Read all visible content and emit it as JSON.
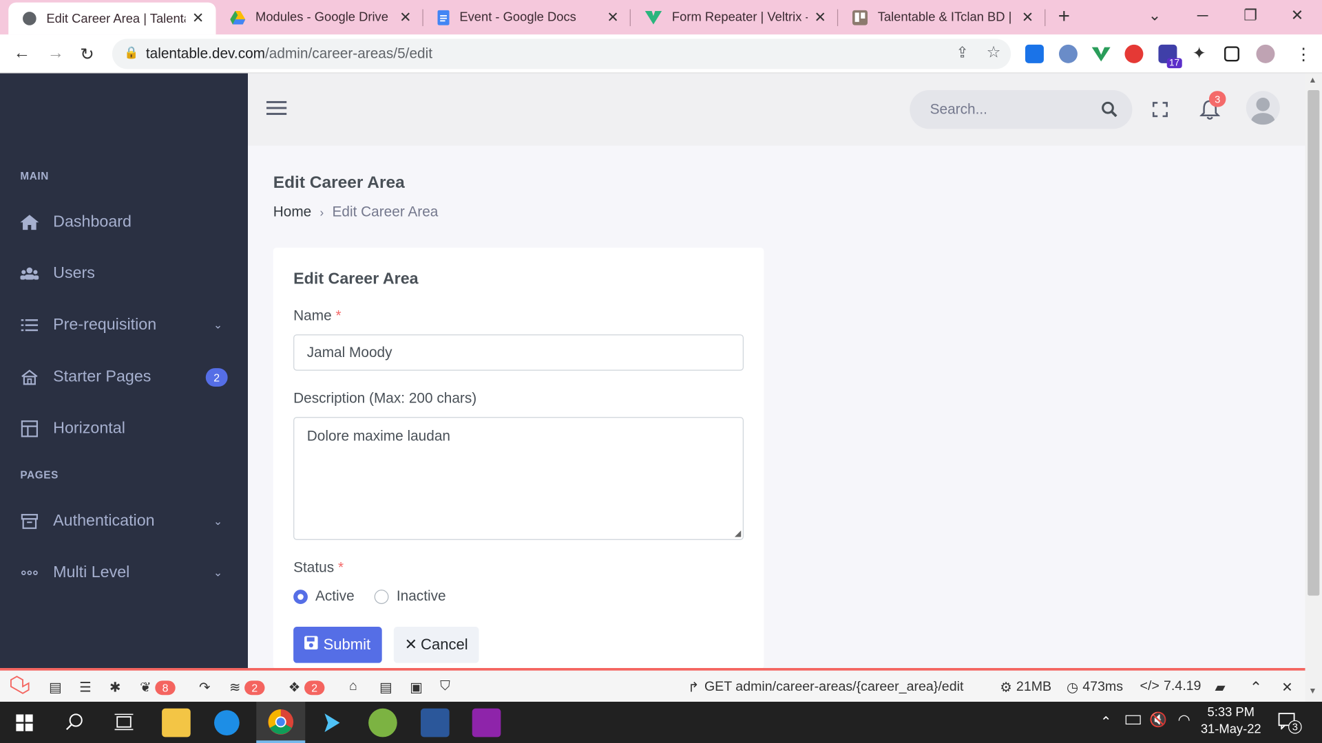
{
  "browser": {
    "tabs": [
      {
        "title": "Edit Career Area | Talentab",
        "active": true
      },
      {
        "title": "Modules - Google Drive",
        "active": false
      },
      {
        "title": "Event - Google Docs",
        "active": false
      },
      {
        "title": "Form Repeater | Veltrix - A",
        "active": false
      },
      {
        "title": "Talentable & ITclan BD | Tr",
        "active": false
      }
    ],
    "url_host": "talentable.dev.com",
    "url_path": "/admin/career-areas/5/edit",
    "ext_badge": "17"
  },
  "sidebar": {
    "section_main": "MAIN",
    "section_pages": "PAGES",
    "items": [
      {
        "label": "Dashboard",
        "icon": "home-icon"
      },
      {
        "label": "Users",
        "icon": "users-icon"
      },
      {
        "label": "Pre-requisition",
        "icon": "list-icon"
      },
      {
        "label": "Starter Pages",
        "icon": "house-outline-icon",
        "badge": "2"
      },
      {
        "label": "Horizontal",
        "icon": "layout-icon"
      },
      {
        "label": "Authentication",
        "icon": "archive-icon"
      },
      {
        "label": "Multi Level",
        "icon": "dots-icon"
      }
    ]
  },
  "header": {
    "search_placeholder": "Search...",
    "notif_count": "3"
  },
  "page": {
    "title": "Edit Career Area",
    "breadcrumb_home": "Home",
    "breadcrumb_current": "Edit Career Area"
  },
  "form": {
    "card_title": "Edit Career Area",
    "name_label": "Name",
    "name_value": "Jamal Moody",
    "desc_label": "Description (Max: 200 chars)",
    "desc_value": "Dolore maxime laudan",
    "status_label": "Status",
    "status_active": "Active",
    "status_inactive": "Inactive",
    "selected_status": "Active",
    "submit_label": "Submit",
    "cancel_label": "Cancel",
    "required_mark": "*"
  },
  "debugbar": {
    "badge_views": "8",
    "badge_queries": "2",
    "badge_models": "2",
    "request": "GET admin/career-areas/{career_area}/edit",
    "memory": "21MB",
    "time": "473ms",
    "php": "7.4.19"
  },
  "taskbar": {
    "time": "5:33 PM",
    "date": "31-May-22",
    "notif_count": "3"
  },
  "colors": {
    "accent": "#556ee6",
    "sidebar": "#2a3042",
    "danger": "#f46a6a",
    "tab_bg": "#f5c8dc"
  }
}
